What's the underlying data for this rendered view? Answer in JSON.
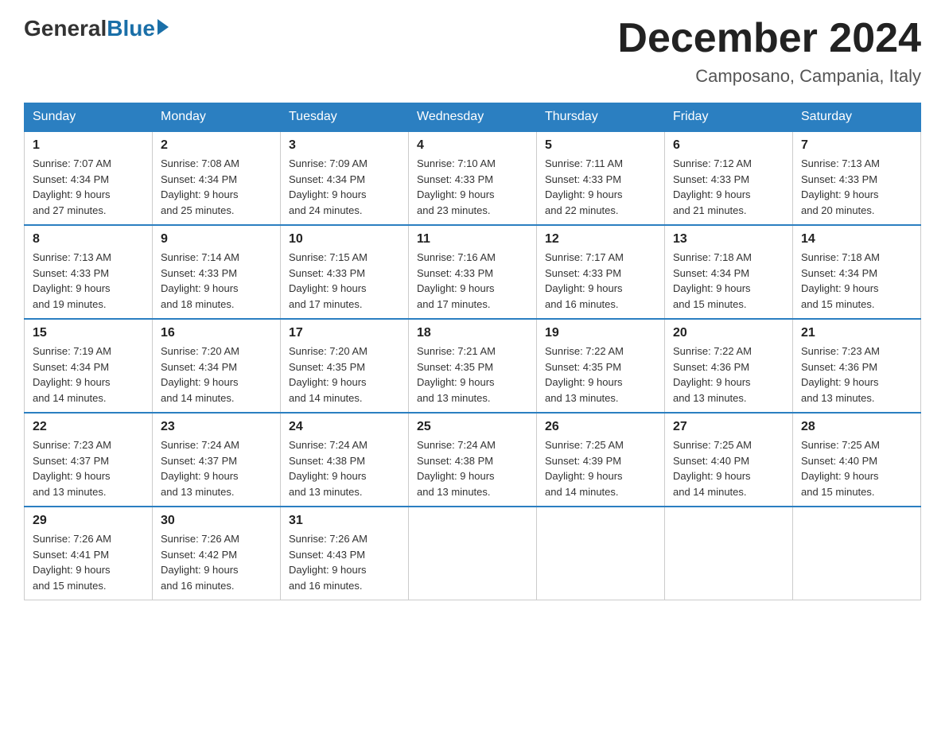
{
  "header": {
    "logo": {
      "general": "General",
      "blue": "Blue"
    },
    "title": "December 2024",
    "location": "Camposano, Campania, Italy"
  },
  "days_of_week": [
    "Sunday",
    "Monday",
    "Tuesday",
    "Wednesday",
    "Thursday",
    "Friday",
    "Saturday"
  ],
  "weeks": [
    [
      {
        "day": "1",
        "sunrise": "7:07 AM",
        "sunset": "4:34 PM",
        "daylight": "9 hours and 27 minutes."
      },
      {
        "day": "2",
        "sunrise": "7:08 AM",
        "sunset": "4:34 PM",
        "daylight": "9 hours and 25 minutes."
      },
      {
        "day": "3",
        "sunrise": "7:09 AM",
        "sunset": "4:34 PM",
        "daylight": "9 hours and 24 minutes."
      },
      {
        "day": "4",
        "sunrise": "7:10 AM",
        "sunset": "4:33 PM",
        "daylight": "9 hours and 23 minutes."
      },
      {
        "day": "5",
        "sunrise": "7:11 AM",
        "sunset": "4:33 PM",
        "daylight": "9 hours and 22 minutes."
      },
      {
        "day": "6",
        "sunrise": "7:12 AM",
        "sunset": "4:33 PM",
        "daylight": "9 hours and 21 minutes."
      },
      {
        "day": "7",
        "sunrise": "7:13 AM",
        "sunset": "4:33 PM",
        "daylight": "9 hours and 20 minutes."
      }
    ],
    [
      {
        "day": "8",
        "sunrise": "7:13 AM",
        "sunset": "4:33 PM",
        "daylight": "9 hours and 19 minutes."
      },
      {
        "day": "9",
        "sunrise": "7:14 AM",
        "sunset": "4:33 PM",
        "daylight": "9 hours and 18 minutes."
      },
      {
        "day": "10",
        "sunrise": "7:15 AM",
        "sunset": "4:33 PM",
        "daylight": "9 hours and 17 minutes."
      },
      {
        "day": "11",
        "sunrise": "7:16 AM",
        "sunset": "4:33 PM",
        "daylight": "9 hours and 17 minutes."
      },
      {
        "day": "12",
        "sunrise": "7:17 AM",
        "sunset": "4:33 PM",
        "daylight": "9 hours and 16 minutes."
      },
      {
        "day": "13",
        "sunrise": "7:18 AM",
        "sunset": "4:34 PM",
        "daylight": "9 hours and 15 minutes."
      },
      {
        "day": "14",
        "sunrise": "7:18 AM",
        "sunset": "4:34 PM",
        "daylight": "9 hours and 15 minutes."
      }
    ],
    [
      {
        "day": "15",
        "sunrise": "7:19 AM",
        "sunset": "4:34 PM",
        "daylight": "9 hours and 14 minutes."
      },
      {
        "day": "16",
        "sunrise": "7:20 AM",
        "sunset": "4:34 PM",
        "daylight": "9 hours and 14 minutes."
      },
      {
        "day": "17",
        "sunrise": "7:20 AM",
        "sunset": "4:35 PM",
        "daylight": "9 hours and 14 minutes."
      },
      {
        "day": "18",
        "sunrise": "7:21 AM",
        "sunset": "4:35 PM",
        "daylight": "9 hours and 13 minutes."
      },
      {
        "day": "19",
        "sunrise": "7:22 AM",
        "sunset": "4:35 PM",
        "daylight": "9 hours and 13 minutes."
      },
      {
        "day": "20",
        "sunrise": "7:22 AM",
        "sunset": "4:36 PM",
        "daylight": "9 hours and 13 minutes."
      },
      {
        "day": "21",
        "sunrise": "7:23 AM",
        "sunset": "4:36 PM",
        "daylight": "9 hours and 13 minutes."
      }
    ],
    [
      {
        "day": "22",
        "sunrise": "7:23 AM",
        "sunset": "4:37 PM",
        "daylight": "9 hours and 13 minutes."
      },
      {
        "day": "23",
        "sunrise": "7:24 AM",
        "sunset": "4:37 PM",
        "daylight": "9 hours and 13 minutes."
      },
      {
        "day": "24",
        "sunrise": "7:24 AM",
        "sunset": "4:38 PM",
        "daylight": "9 hours and 13 minutes."
      },
      {
        "day": "25",
        "sunrise": "7:24 AM",
        "sunset": "4:38 PM",
        "daylight": "9 hours and 13 minutes."
      },
      {
        "day": "26",
        "sunrise": "7:25 AM",
        "sunset": "4:39 PM",
        "daylight": "9 hours and 14 minutes."
      },
      {
        "day": "27",
        "sunrise": "7:25 AM",
        "sunset": "4:40 PM",
        "daylight": "9 hours and 14 minutes."
      },
      {
        "day": "28",
        "sunrise": "7:25 AM",
        "sunset": "4:40 PM",
        "daylight": "9 hours and 15 minutes."
      }
    ],
    [
      {
        "day": "29",
        "sunrise": "7:26 AM",
        "sunset": "4:41 PM",
        "daylight": "9 hours and 15 minutes."
      },
      {
        "day": "30",
        "sunrise": "7:26 AM",
        "sunset": "4:42 PM",
        "daylight": "9 hours and 16 minutes."
      },
      {
        "day": "31",
        "sunrise": "7:26 AM",
        "sunset": "4:43 PM",
        "daylight": "9 hours and 16 minutes."
      },
      null,
      null,
      null,
      null
    ]
  ],
  "labels": {
    "sunrise": "Sunrise:",
    "sunset": "Sunset:",
    "daylight": "Daylight: 9 hours"
  }
}
